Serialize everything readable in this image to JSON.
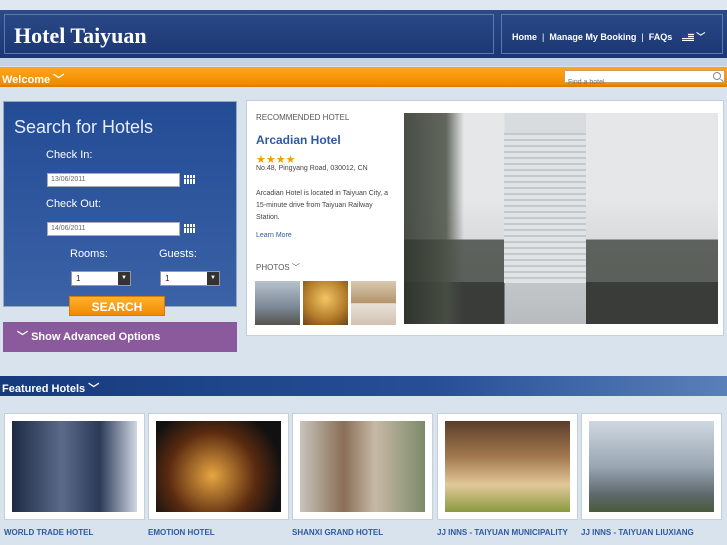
{
  "header": {
    "logo": "Hotel Taiyuan",
    "nav": [
      "Home",
      "Manage My Booking",
      "FAQs"
    ],
    "nav_separator": "|",
    "language_icon": "us-flag-icon"
  },
  "welcome_bar": {
    "label": "Welcome",
    "search_placeholder": "Find a hotel"
  },
  "search_panel": {
    "title": "Search for Hotels",
    "check_in_label": "Check In:",
    "check_in_value": "13/06/2011",
    "check_out_label": "Check Out:",
    "check_out_value": "14/06/2011",
    "rooms_label": "Rooms:",
    "rooms_value": "1",
    "guests_label": "Guests:",
    "guests_value": "1",
    "search_button": "SEARCH",
    "advanced_label": "Show Advanced Options"
  },
  "recommended": {
    "kicker": "RECOMMENDED HOTEL",
    "name": "Arcadian Hotel",
    "stars": "★★★★",
    "star_count": 4,
    "address": "No.48, Pingyang Road, 030012, CN",
    "description": "Arcadian Hotel is located in Taiyuan City, a 15-minute drive from Taiyuan Railway Station.",
    "more_link": "Learn More",
    "photos_label": "PHOTOS"
  },
  "featured": {
    "label": "Featured Hotels",
    "hotels": [
      {
        "name": "WORLD TRADE HOTEL"
      },
      {
        "name": "EMOTION HOTEL"
      },
      {
        "name": "SHANXI GRAND HOTEL"
      },
      {
        "name": "JJ INNS - TAIYUAN MUNICIPALITY"
      },
      {
        "name": "JJ INNS - TAIYUAN LIUXIANG"
      }
    ]
  },
  "colors": {
    "header_blue": "#1c3672",
    "accent_orange": "#f08a00",
    "link_blue": "#2d5aa0",
    "advanced_purple": "#8a5a9c"
  }
}
